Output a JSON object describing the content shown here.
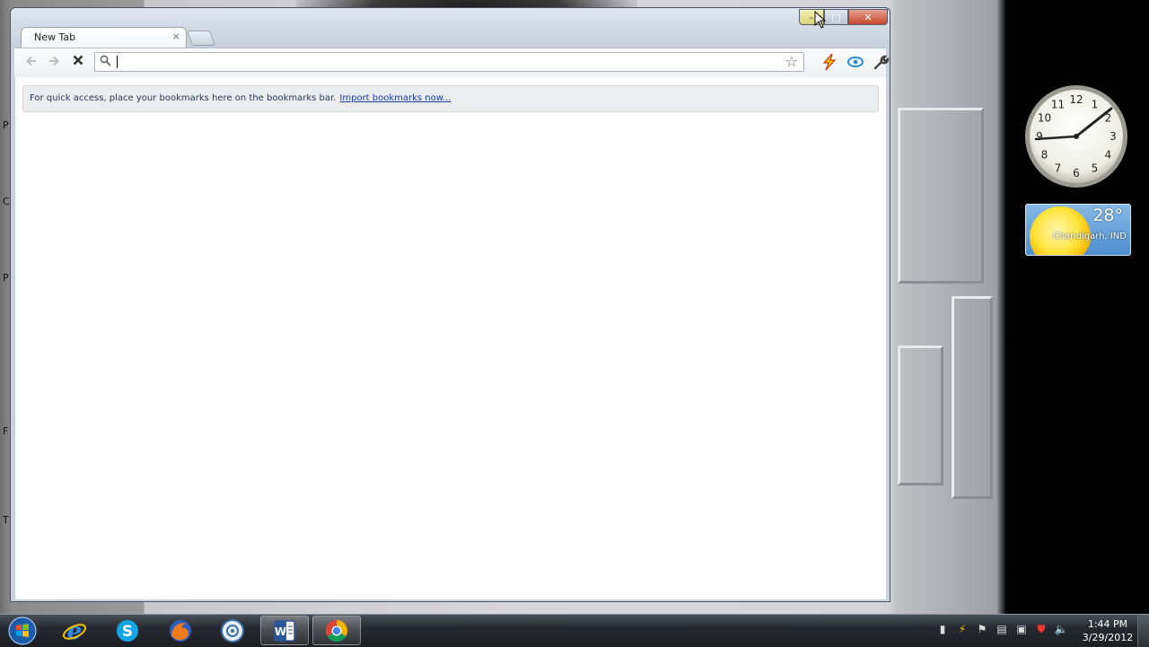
{
  "browser": {
    "tab_title": "New Tab",
    "tab_close": "×",
    "omnibox_value": "",
    "bookmarks_message": "For quick access, place your bookmarks here on the bookmarks bar.",
    "import_link": "Import bookmarks now...",
    "window_buttons": {
      "minimize": "–",
      "maximize": "□",
      "close": "✕"
    }
  },
  "gadgets": {
    "clock_numbers": [
      "12",
      "1",
      "2",
      "3",
      "4",
      "5",
      "6",
      "7",
      "8",
      "9",
      "10",
      "11"
    ],
    "weather_temp": "28°",
    "weather_location": "Chandigarh, IND"
  },
  "taskbar": {
    "apps": [
      {
        "name": "internet-explorer-icon"
      },
      {
        "name": "skype-icon"
      },
      {
        "name": "firefox-icon"
      },
      {
        "name": "media-center-icon"
      },
      {
        "name": "word-icon"
      },
      {
        "name": "chrome-icon"
      }
    ],
    "time": "1:44 PM",
    "date": "3/29/2012"
  },
  "desktop_edge_letters": [
    "P",
    "C",
    "P",
    "F",
    "T"
  ],
  "colors": {
    "weather_bg": "#4e8ed0",
    "link": "#1a3da6",
    "close_button": "#c3492c"
  }
}
